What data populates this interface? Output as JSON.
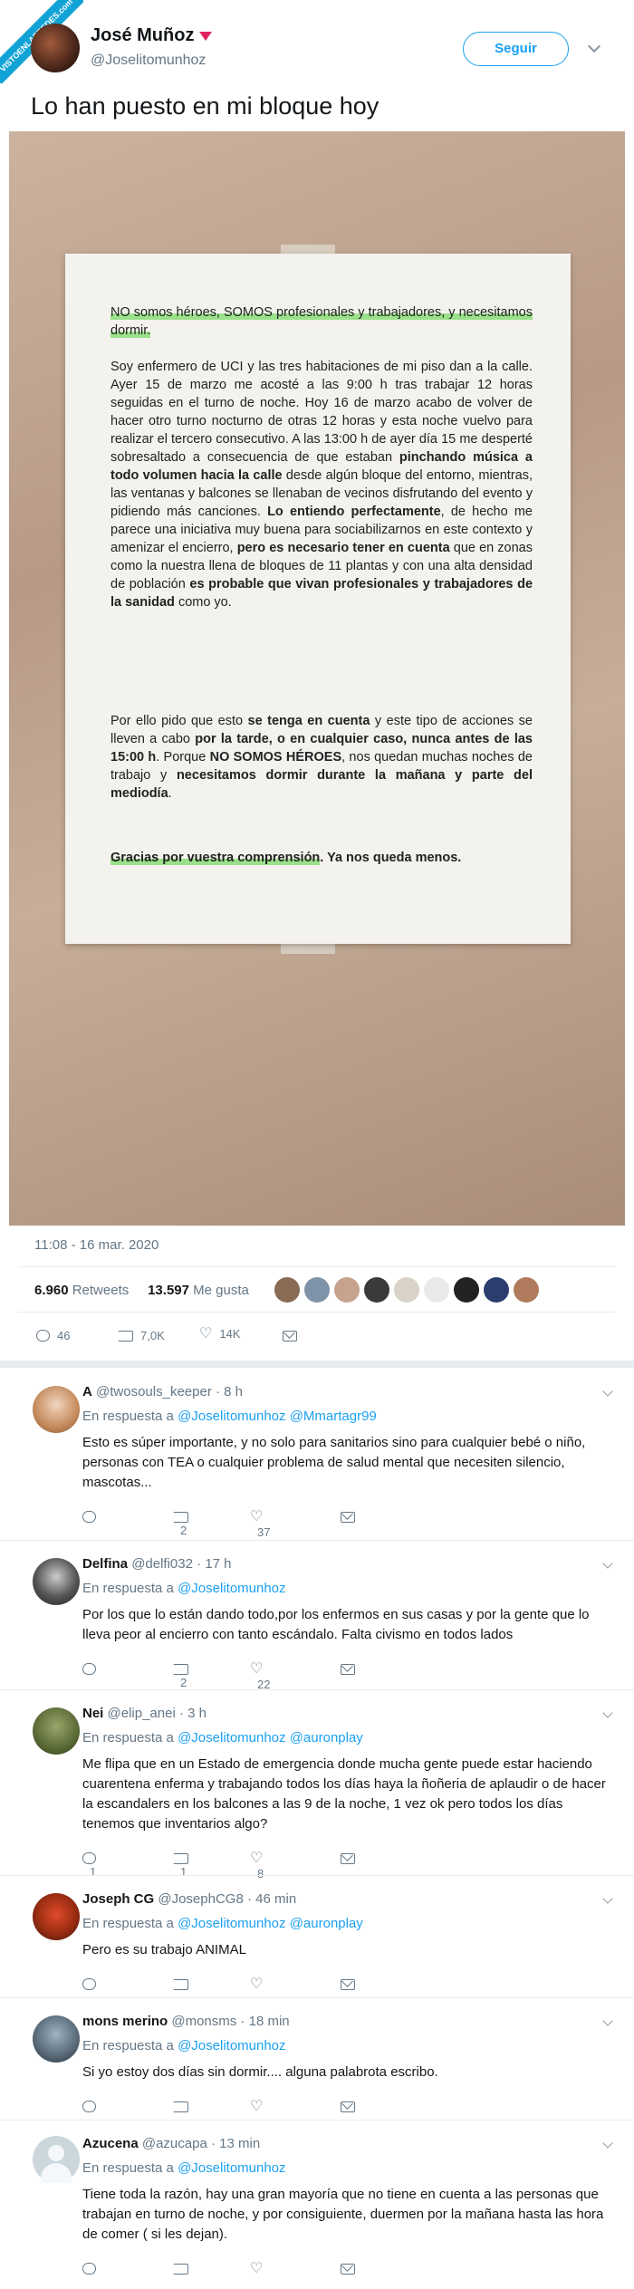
{
  "badge": "VISTOENLASREDES.com",
  "author": {
    "name": "José Muñoz",
    "handle": "@Joselitomunhoz"
  },
  "follow_label": "Seguir",
  "tweet_text": "Lo han puesto en mi bloque hoy",
  "letter": {
    "p1": "NO somos héroes, SOMOS profesionales y trabajadores, y necesitamos dormir.",
    "p2a": "Soy enfermero de UCI y las tres habitaciones de mi piso dan a la calle. Ayer 15 de marzo me acosté a las 9:00 h tras trabajar 12 horas seguidas en el turno de noche. Hoy 16 de marzo acabo de volver de hacer otro turno nocturno de otras 12 horas y esta noche vuelvo para realizar el tercero consecutivo. A las 13:00 h de ayer día 15 me desperté sobresaltado a consecuencia de que estaban ",
    "p2b": "pinchando música a todo volumen hacia la calle",
    "p2c": " desde algún bloque del entorno, mientras, las ventanas y balcones se llenaban de vecinos disfrutando del evento y pidiendo más canciones. ",
    "p2d": "Lo entiendo perfectamente",
    "p2e": ", de hecho me parece una iniciativa muy buena para sociabilizarnos en este contexto y amenizar el encierro, ",
    "p2f": "pero es necesario tener en cuenta",
    "p2g": " que en zonas como la nuestra llena de bloques de 11 plantas y con una alta densidad de población ",
    "p2h": "es probable que vivan profesionales y trabajadores de la sanidad",
    "p2i": " como yo.",
    "p3a": "Por ello pido que esto ",
    "p3b": "se tenga en cuenta",
    "p3c": " y este tipo de acciones se lleven a cabo ",
    "p3d": "por la tarde, o en cualquier caso, nunca antes de las 15:00 h",
    "p3e": ". Porque ",
    "p3f": "NO SOMOS HÉROES",
    "p3g": ", nos quedan muchas noches de trabajo y ",
    "p3h": "necesitamos dormir durante la mañana y parte del mediodía",
    "p3i": ".",
    "p4a": "Gracias por vuestra comprensión",
    "p4b": ". Ya nos queda menos."
  },
  "timestamp": "11:08 - 16 mar. 2020",
  "stats": {
    "retweets": "6.960",
    "retweets_label": "Retweets",
    "likes": "13.597",
    "likes_label": "Me gusta"
  },
  "actions": {
    "replies": "46",
    "retweets": "7,0K",
    "likes": "14K"
  },
  "replies": [
    {
      "name": "A",
      "handle": "@twosouls_keeper",
      "time": "8 h",
      "resp": "En respuesta a",
      "mentions": "@Joselitomunhoz @Mmartagr99",
      "text": "Esto es súper importante, y no solo para sanitarios sino para cualquier bebé o niño, personas con TEA o cualquier problema de salud mental que necesiten silencio, mascotas...",
      "reply_count": "",
      "rt_count": "2",
      "like_count": "37"
    },
    {
      "name": "Delfina",
      "handle": "@delfi032",
      "time": "17 h",
      "resp": "En respuesta a",
      "mentions": "@Joselitomunhoz",
      "text": "Por los que lo están dando todo,por los enfermos en sus casas y por la gente que lo lleva peor al encierro con tanto escándalo. Falta civismo en todos lados",
      "reply_count": "",
      "rt_count": "2",
      "like_count": "22"
    },
    {
      "name": "Nei",
      "handle": "@elip_anei",
      "time": "3 h",
      "resp": "En respuesta a",
      "mentions": "@Joselitomunhoz @auronplay",
      "text": "Me flipa que en un Estado de emergencia donde mucha gente puede estar haciendo cuarentena enferma y trabajando todos los días haya la ñoñeria de aplaudir o de hacer la escandalers en los balcones a las 9 de la noche, 1 vez ok pero todos los días tenemos que inventarios algo?",
      "reply_count": "1",
      "rt_count": "1",
      "like_count": "8"
    },
    {
      "name": "Joseph CG",
      "handle": "@JosephCG8",
      "time": "46 min",
      "resp": "En respuesta a",
      "mentions": "@Joselitomunhoz @auronplay",
      "text": "Pero es su trabajo ANIMAL",
      "reply_count": "",
      "rt_count": "",
      "like_count": ""
    },
    {
      "name": "mons merino",
      "handle": "@monsms",
      "time": "18 min",
      "resp": "En respuesta a",
      "mentions": "@Joselitomunhoz",
      "text": "Si yo estoy dos días sin dormir.... alguna palabrota escribo.",
      "reply_count": "",
      "rt_count": "",
      "like_count": ""
    },
    {
      "name": "Azucena",
      "handle": "@azucapa",
      "time": "13 min",
      "resp": "En respuesta a",
      "mentions": "@Joselitomunhoz",
      "text": "Tiene toda la razón, hay una gran mayoría que no tiene en cuenta a las personas que trabajan en turno de noche, y por consiguiente, duermen por la mañana hasta las hora de comer ( si les dejan).",
      "reply_count": "",
      "rt_count": "",
      "like_count": ""
    }
  ],
  "colors": {
    "accent": "#1da1f2",
    "muted": "#657786",
    "highlight": "#9be08a"
  }
}
